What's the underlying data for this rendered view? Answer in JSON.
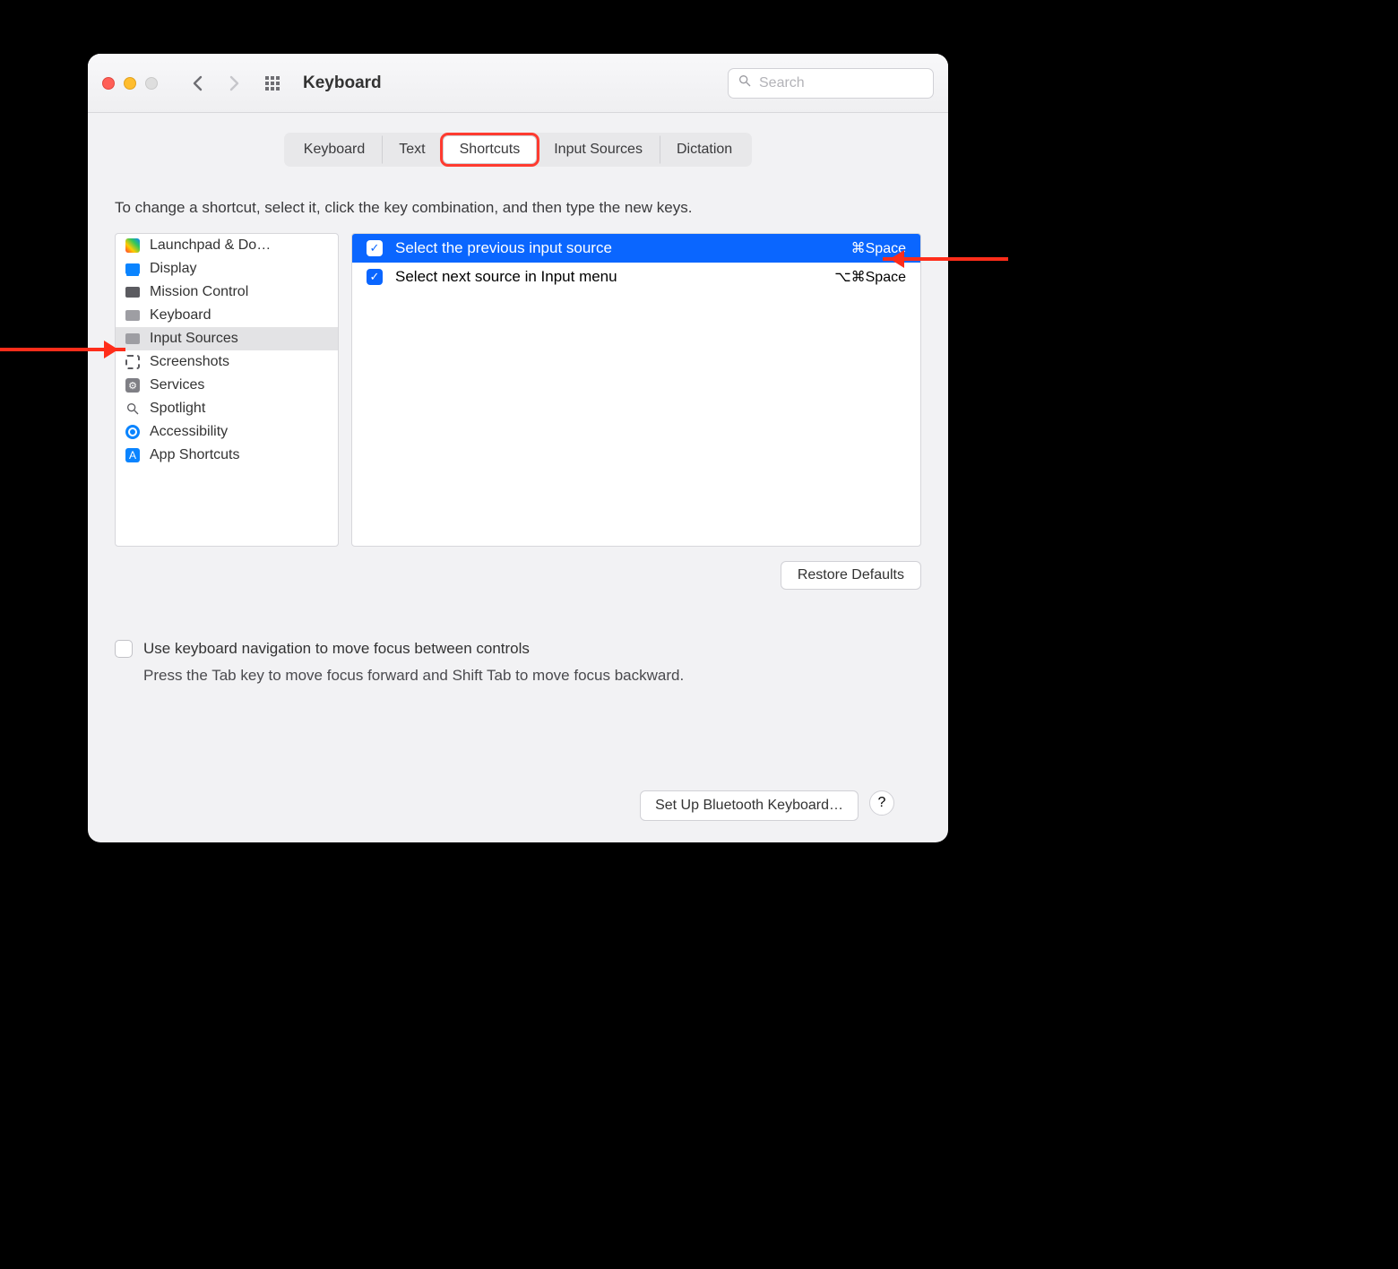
{
  "toolbar": {
    "title": "Keyboard",
    "search_placeholder": "Search"
  },
  "tabs": [
    {
      "label": "Keyboard",
      "active": false
    },
    {
      "label": "Text",
      "active": false
    },
    {
      "label": "Shortcuts",
      "active": true
    },
    {
      "label": "Input Sources",
      "active": false
    },
    {
      "label": "Dictation",
      "active": false
    }
  ],
  "instructions": "To change a shortcut, select it, click the key combination, and then type the new keys.",
  "sidebar": {
    "items": [
      {
        "label": "Launchpad & Do…",
        "icon": "launchpad-icon",
        "selected": false
      },
      {
        "label": "Display",
        "icon": "display-icon",
        "selected": false
      },
      {
        "label": "Mission Control",
        "icon": "mission-control-icon",
        "selected": false
      },
      {
        "label": "Keyboard",
        "icon": "keyboard-icon",
        "selected": false
      },
      {
        "label": "Input Sources",
        "icon": "input-sources-icon",
        "selected": true
      },
      {
        "label": "Screenshots",
        "icon": "screenshot-icon",
        "selected": false
      },
      {
        "label": "Services",
        "icon": "services-icon",
        "selected": false
      },
      {
        "label": "Spotlight",
        "icon": "spotlight-icon",
        "selected": false
      },
      {
        "label": "Accessibility",
        "icon": "accessibility-icon",
        "selected": false
      },
      {
        "label": "App Shortcuts",
        "icon": "app-shortcuts-icon",
        "selected": false
      }
    ]
  },
  "shortcuts": [
    {
      "label": "Select the previous input source",
      "keys": "⌘Space",
      "checked": true,
      "selected": true
    },
    {
      "label": "Select next source in Input menu",
      "keys": "⌥⌘Space",
      "checked": true,
      "selected": false
    }
  ],
  "buttons": {
    "restore": "Restore Defaults",
    "bluetooth": "Set Up Bluetooth Keyboard…",
    "help": "?"
  },
  "nav_checkbox_label": "Use keyboard navigation to move focus between controls",
  "nav_hint": "Press the Tab key to move focus forward and Shift Tab to move focus backward."
}
